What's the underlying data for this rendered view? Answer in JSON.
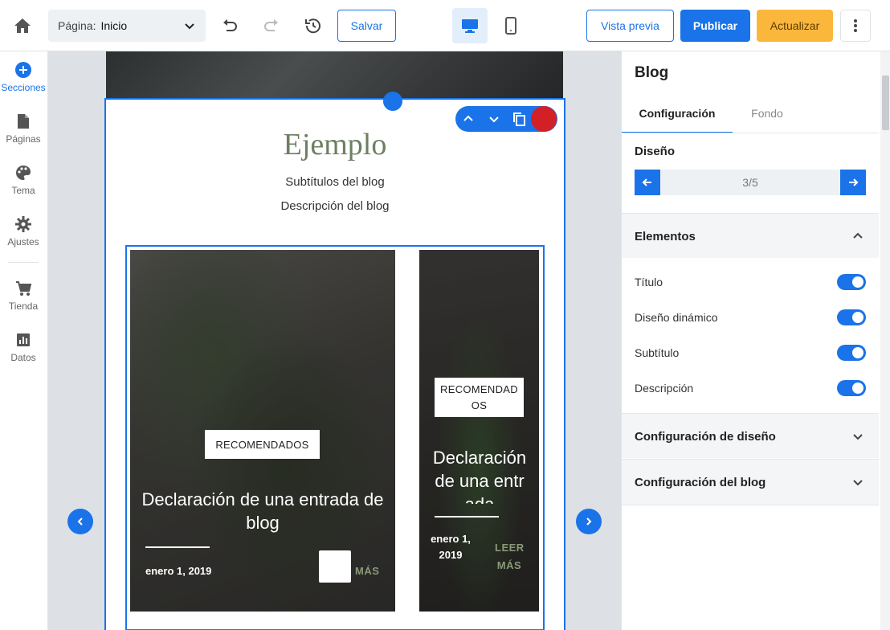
{
  "topbar": {
    "page_label": "Página:",
    "page_value": "Inicio",
    "save_label": "Salvar",
    "preview_label": "Vista previa",
    "publish_label": "Publicar",
    "update_label": "Actualizar"
  },
  "leftnav": {
    "items": [
      {
        "label": "Secciones",
        "icon": "plus-circle-icon",
        "active": true
      },
      {
        "label": "Páginas",
        "icon": "page-icon"
      },
      {
        "label": "Tema",
        "icon": "palette-icon"
      },
      {
        "label": "Ajustes",
        "icon": "gear-icon"
      },
      {
        "label": "Tienda",
        "icon": "cart-icon"
      },
      {
        "label": "Datos",
        "icon": "chart-icon"
      }
    ]
  },
  "canvas": {
    "blog_title": "Ejemplo",
    "blog_subtitle": "Subtítulos del blog",
    "blog_description": "Descripción del blog",
    "cards": [
      {
        "badge": "RECOMENDADOS",
        "title": "Declaración de una entrada de blog",
        "date": "enero 1, 2019",
        "more": "MÁS"
      },
      {
        "badge": "RECOMENDADOS",
        "title": "Declaración de una entrada",
        "date": "enero 1, 2019",
        "more": "LEER MÁS"
      }
    ]
  },
  "panel": {
    "title": "Blog",
    "tabs": [
      "Configuración",
      "Fondo"
    ],
    "design_heading": "Diseño",
    "design_value": "3/5",
    "elements_heading": "Elementos",
    "toggles": [
      {
        "label": "Título",
        "on": true
      },
      {
        "label": "Diseño dinámico",
        "on": true
      },
      {
        "label": "Subtítulo",
        "on": true
      },
      {
        "label": "Descripción",
        "on": true
      }
    ],
    "design_config_label": "Configuración de diseño",
    "blog_config_label": "Configuración del blog"
  },
  "colors": {
    "accent": "#1a73e8",
    "warning": "#fbb73c",
    "delete": "#d32027"
  }
}
